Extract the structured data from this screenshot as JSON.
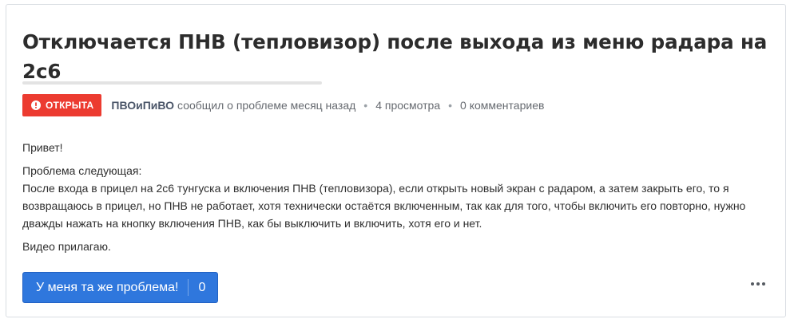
{
  "topic": {
    "title": "Отключается ПНВ (тепловизор) после выхода из меню радара на 2с6",
    "status_label": "ОТКРЫТА",
    "status_color": "#ec3b30",
    "status_icon": "alert-circle-icon",
    "author": "ПВОиПиВО",
    "reported_text": "сообщил о проблеме месяц назад",
    "views": "4 просмотра",
    "comments": "0 комментариев"
  },
  "body": {
    "greeting": "Привет!",
    "problem_heading": "Проблема следующая:",
    "problem_text": "После входа в прицел на 2с6 тунгуска и включения ПНВ (тепловизора), если открыть новый экран с радаром, а затем закрыть его, то я возвращаюсь в прицел, но ПНВ не работает, хотя технически остаётся включенным, так как для того, чтобы включить его повторно, нужно дважды нажать на кнопку включения ПНВ, как бы выключить и включить, хотя его и нет.",
    "video_note": "Видео прилагаю."
  },
  "actions": {
    "me_too_label": "У меня та же проблема!",
    "me_too_count": "0",
    "accent_color": "#2f77dd",
    "more_icon": "more-horizontal-icon"
  }
}
